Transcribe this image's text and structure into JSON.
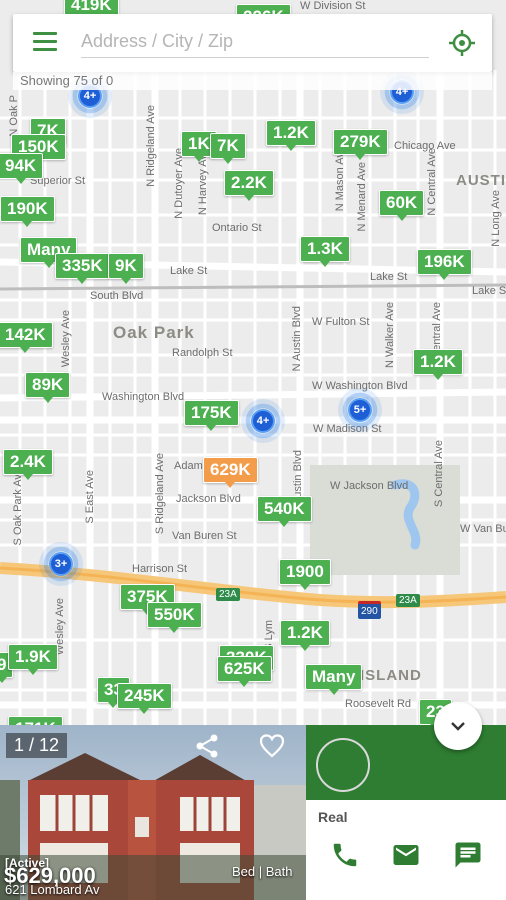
{
  "search": {
    "placeholder": "Address / City / Zip",
    "status_text": "Showing 75 of 0"
  },
  "map": {
    "area_labels": [
      "Oak Park",
      "AUSTI",
      "ISLAND"
    ],
    "streets": {
      "w_division": "W Division St",
      "chicago_ave": "Chicago Ave",
      "superior": "Superior St",
      "ontario": "Ontario St",
      "lake": "Lake St",
      "lake_st_e": "Lake St",
      "lake_st_far": "Lake Ste",
      "south_blvd": "South Blvd",
      "w_fulton": "W Fulton St",
      "randolph": "Randolph St",
      "washington": "Washington Blvd",
      "w_washington": "W Washington Blvd",
      "w_madison": "W Madison St",
      "adams": "Adam",
      "jackson": "Jackson Blvd",
      "w_jackson": "W Jackson Blvd",
      "van_buren": "Van Buren St",
      "w_van_buren": "W Van Bu",
      "harrison": "Harrison St",
      "roosevelt": "Roosevelt Rd",
      "n_ridgeland": "N Ridgeland Ave",
      "n_dutoyer": "N Dutoyer Ave",
      "n_harvey": "N Harvey Ave",
      "n_oak_park": "N Oak P",
      "n_austin": "N Austin Blvd",
      "n_mason": "N Mason Ave",
      "n_menard": "N Menard Ave",
      "n_central": "N Central Ave",
      "n_central2": "N Central Ave",
      "n_walker": "N Walker Ave",
      "n_long": "N Long Ave",
      "wesley": "Wesley Ave",
      "wesley2": "Wesley Ave",
      "s_oak_park": "S Oak Park Ave",
      "s_east": "S East Ave",
      "s_ridgeland": "S Ridgeland Ave",
      "s_austin": "S Austin Blvd",
      "s_central": "S Central Ave",
      "s_lyman": "S Lym"
    },
    "highway_shields": [
      "23A",
      "290",
      "23A"
    ],
    "price_pins": [
      "419K",
      "226K",
      "7K",
      "150K",
      "94K",
      "190K",
      "Many",
      "335K",
      "9K",
      "1K",
      "7K",
      "1.2K",
      "279K",
      "2.2K",
      "60K",
      "1.3K",
      "196K",
      "142K",
      "89K",
      "175K",
      "1.2K",
      "2.4K",
      "629K",
      "540K",
      "1900",
      "375K",
      "550K",
      "1.2K",
      "9",
      "1.9K",
      "330K",
      "625K",
      "Many",
      "33",
      "245K",
      "23",
      "171K"
    ],
    "clusters": [
      "4+",
      "4+",
      "4+",
      "5+",
      "3+"
    ]
  },
  "listing": {
    "photo_counter": "1 / 12",
    "status": "[Active]",
    "price": "$629,000",
    "address": "621 Lombard Av",
    "bed_bath": "Bed | Bath"
  },
  "agent": {
    "name": "Real"
  },
  "icons": {
    "menu": "menu-icon",
    "locate": "crosshair-icon",
    "share": "share-icon",
    "favorite": "heart-icon",
    "phone": "phone-icon",
    "email": "email-icon",
    "message": "message-icon",
    "collapse": "chevron-down-icon"
  },
  "colors": {
    "accent": "#4caf50",
    "agent_banner": "#2e7d32",
    "selected_pin": "#f39c4a",
    "cluster": "#1f5fd6"
  }
}
